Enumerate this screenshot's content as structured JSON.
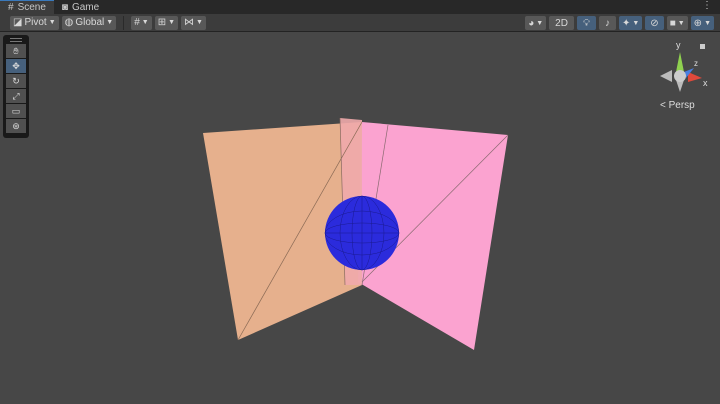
{
  "tabs": [
    {
      "label": "Scene",
      "icon": "grid-icon",
      "active": true
    },
    {
      "label": "Game",
      "icon": "gamepad-icon",
      "active": false
    }
  ],
  "toolbar": {
    "pivot": "Pivot",
    "global": "Global",
    "twod": "2D"
  },
  "tools": [
    "view-hand",
    "move",
    "rotate",
    "scale",
    "rect",
    "transform"
  ],
  "gizmo": {
    "y": "y",
    "x": "x",
    "z": "z",
    "projection": "Persp"
  },
  "colors": {
    "plane_left": "#e6b08d",
    "plane_right": "#fba3d0",
    "sphere": "#2b2bdc",
    "accent": "#46607c"
  }
}
